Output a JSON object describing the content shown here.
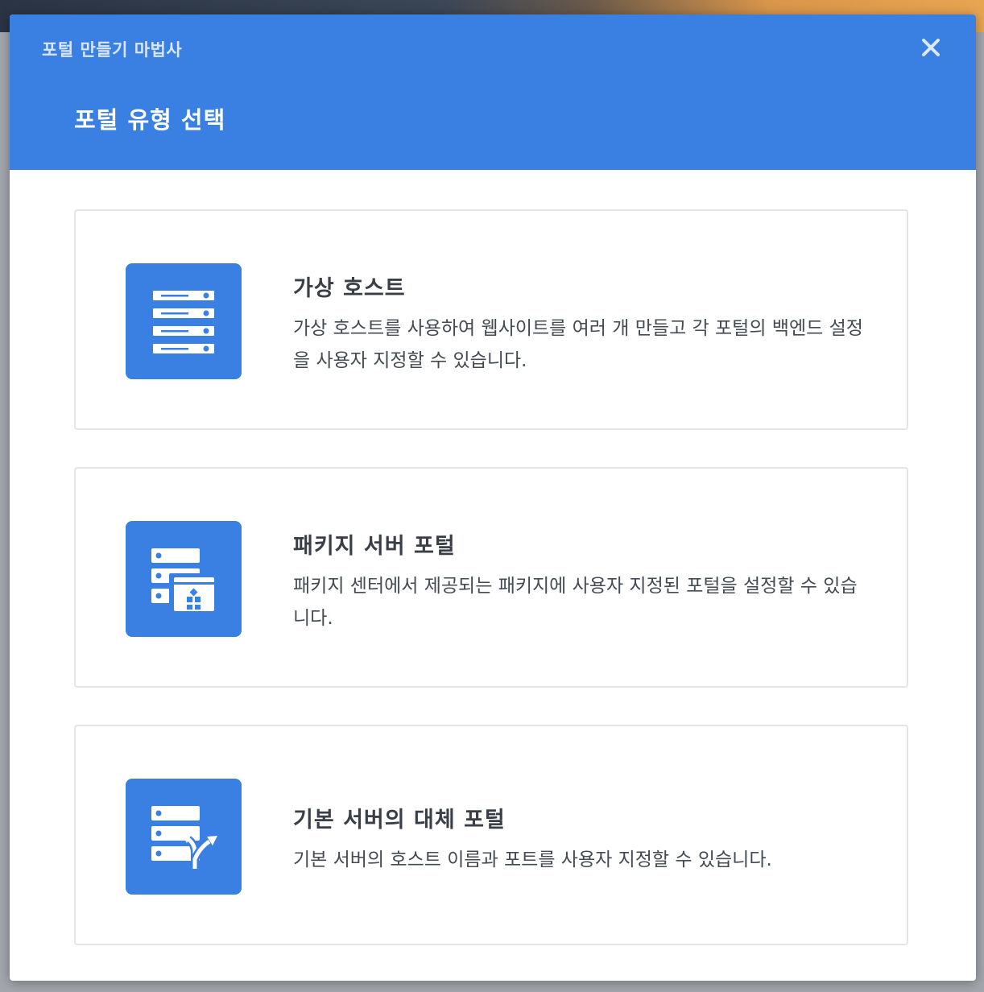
{
  "dialog": {
    "wizard_title": "포털 만들기 마법사",
    "step_title": "포털 유형 선택",
    "header_color": "#3a7fe2",
    "close_icon": "close-icon"
  },
  "options": [
    {
      "title": "가상 호스트",
      "description": "가상 호스트를 사용하여 웹사이트를 여러 개 만들고 각 포털의 백엔드 설정을 사용자 지정할 수 있습니다.",
      "icon": "server-stack-icon"
    },
    {
      "title": "패키지 서버 포털",
      "description": "패키지 센터에서 제공되는 패키지에 사용자 지정된 포털을 설정할 수 있습니다.",
      "icon": "package-server-icon"
    },
    {
      "title": "기본 서버의 대체 포털",
      "description": "기본 서버의 호스트 이름과 포트를 사용자 지정할 수 있습니다.",
      "icon": "server-redirect-icon"
    }
  ]
}
